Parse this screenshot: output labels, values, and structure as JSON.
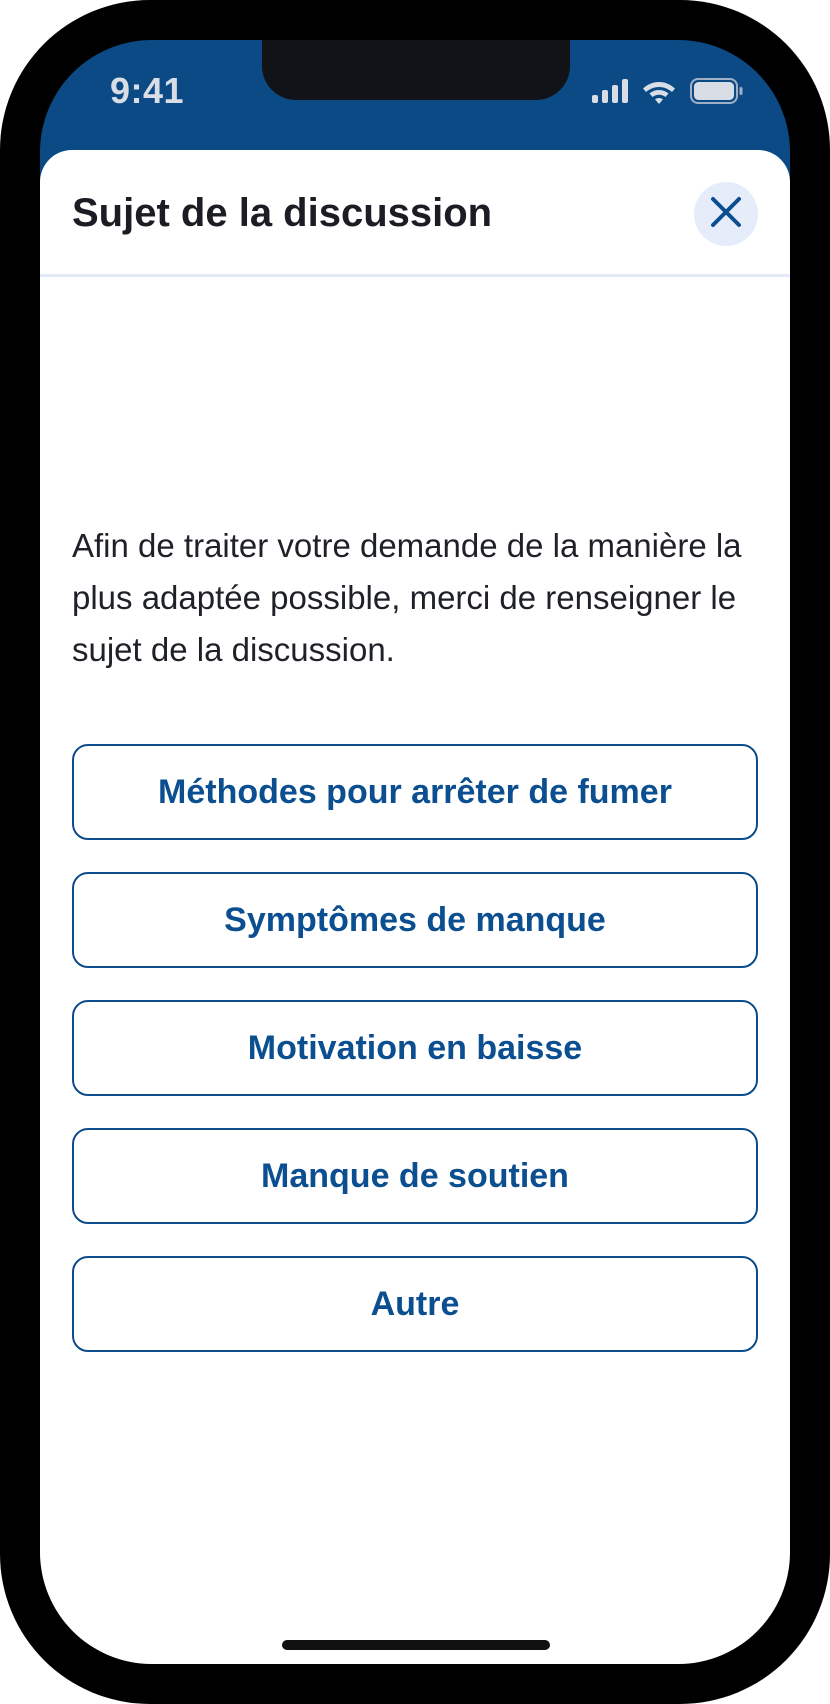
{
  "status_bar": {
    "time": "9:41",
    "icons": [
      "cellular-signal-icon",
      "wifi-icon",
      "battery-icon"
    ]
  },
  "sheet": {
    "title": "Sujet de la discussion",
    "close_icon": "close-icon",
    "intro": "Afin de traiter votre demande de la manière la plus adaptée possible, merci de renseigner le sujet de la discussion.",
    "options": [
      "Méthodes pour arrêter de fumer",
      "Symptômes de manque",
      "Motivation en baisse",
      "Manque de soutien",
      "Autre"
    ]
  },
  "colors": {
    "header_blue": "#0c4a85",
    "accent_blue": "#0b4f91",
    "close_bg": "#e5ecfa",
    "divider": "#e4ebf8",
    "text_dark": "#1b1c24"
  }
}
